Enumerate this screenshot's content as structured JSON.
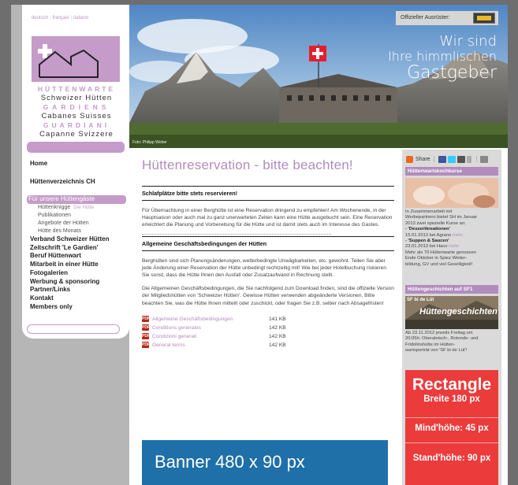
{
  "languages": [
    "deutsch",
    "français",
    "italiano"
  ],
  "brand": {
    "l1": "HÜTTENWARTE",
    "l2": "Schweizer Hütten",
    "l3": "GARDIENS",
    "l4": "Cabanes Suisses",
    "l5": "GUARDIANI",
    "l6": "Capanne Svizzere"
  },
  "nav": {
    "home": "Home",
    "verzeichnis": "Hüttenverzeichnis CH",
    "active": "Für unsere Hüttengäste",
    "sub1": "Hüttenknigge",
    "sub1_ghost": "Der Hütte",
    "sub2": "Publikationen",
    "sub3": "Angebote der Hütten",
    "sub4": "Hütte des Monats",
    "verband": "Verband Schweizer Hütten",
    "zeitschrift": "Zeitschrift 'Le Gardien'",
    "beruf": "Beruf Hüttenwart",
    "mitarbeit": "Mitarbeit in einer Hütte",
    "fotogalerien": "Fotogalerien",
    "werbung": "Werbung & sponsoring",
    "partner": "Partner/Links",
    "kontakt": "Kontakt",
    "members": "Members only"
  },
  "hero": {
    "sponsor_label": "Offizieller Ausrüster:",
    "slogan1": "Wir sind",
    "slogan2": "Ihre himmlischen",
    "slogan3": "Gastgeber",
    "credit": "Foto: Philipp Weber"
  },
  "main": {
    "title": "Hüttenreservation - bitte beachten!",
    "section1_title": "Schlafplätze bitte stets reservieren!",
    "section1_text": "Für Übernachtung in einer Berghütte ist eine Reservation dringend zu empfehlen! Am Wochenende, in der Hauptsaison oder auch mal zu ganz unerwarteten Zeiten kann eine Hütte ausgebucht sein. Eine Reservation erleichtert die Planung und Vorbereitung für die Hütte und ist damit stets auch im Interesse des Gastes.",
    "section2_title": "Allgemeine Geschäftsbedingungen der Hütten",
    "section2_text1": "Berghütten sind sich Planungsänderungen, wetterbedingte Unwägbarkeiten, etc. gewohnt. Teilen Sie aber jede Änderung einer Reservation der Hütte unbedingt rechtzeitig mit! Wie bei jeder Hotelbuchung riskieren Sie sonst, dass die Hütte Ihnen den Ausfall oder Zusatzaufwand in Rechnung stellt.",
    "section2_text2": "Die Allgemeinen Geschäftsbedingungen, die Sie nachfolgend zum Download finden, sind die offizielle Version der Mitgliedshütten von 'Schweizer Hütten'. Gewisse Hütten verwenden abgeänderte Versionen. Bitte beachten Sie, was die Hütte Ihnen mitteilt oder zuschickt, oder fragen Sie z.B. selber nach Absagefristen!",
    "documents": [
      {
        "name": "Allgemeine Geschäftsbedingungen",
        "size": "141 KB"
      },
      {
        "name": "Conditions generales",
        "size": "142 KB"
      },
      {
        "name": "Condizioni generali",
        "size": "142 KB"
      },
      {
        "name": "General terms",
        "size": "142 KB"
      }
    ],
    "banner": "Banner 480 x 90 px"
  },
  "right": {
    "share": "Share",
    "box1_head": "Hüttenwartskochkurse",
    "box1_l1": "In Zusammenarbeit mit",
    "box1_l2": "Werbepartnern bietet SH im Januar",
    "box1_l3": "2013 zwei spezielle Kurse an:",
    "box1_k1": "- 'Dessertkreationen'",
    "box1_k1d": "15.01.2013 bei Agrano",
    "box1_k1m": "mehr",
    "box1_k2": "- 'Suppen & Saucen'",
    "box1_k2d": "23.01.2013 bei Haco",
    "box1_k2m": "mehr",
    "box1_l4": "Mehr als 70 Hüttenwarte genossen",
    "box1_l5": "Ende Oktober in Spiez Weiter-",
    "box1_l6": "bildung, GV und viel Geselligkeit!",
    "box2_head": "Hüttengeschichten auf SF1",
    "box2_img": "Hüttengeschichten",
    "box2_img_top": "SF bi de Lüt",
    "box2_l1": "Ab 23.11.2012 jeweils Freitag um",
    "box2_l2": "20:05h: Oberaletsch-, Rotondo- und",
    "box2_l3": "Fridolinshütte im Hütten-",
    "box2_l4": "wartsporträt von 'SF bi de Lüt'!",
    "ad_title": "Rectangle",
    "ad_width": "Breite 180 px",
    "ad_min": "Mind'höhe: 45 px",
    "ad_std": "Stand'höhe: 90 px"
  },
  "colors": {
    "brand_lilac": "#c59bc9",
    "title_lilac": "#b28cbd",
    "banner_blue": "#1f6fa8",
    "ad_red": "#eb3b3b"
  }
}
